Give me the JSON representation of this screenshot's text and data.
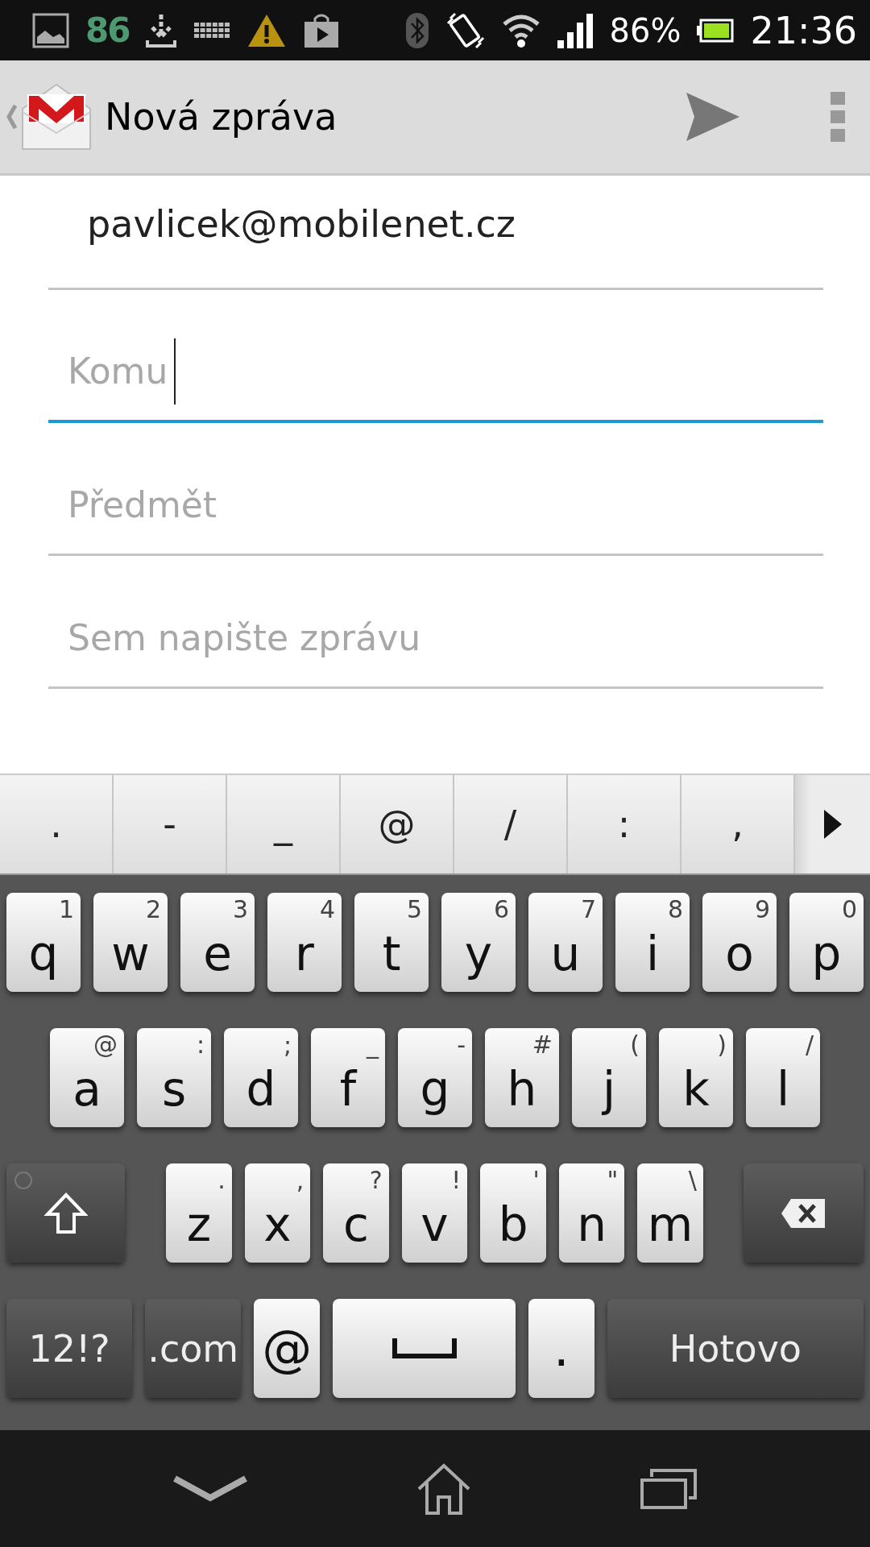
{
  "status_bar": {
    "notification_count": "86",
    "battery": "86%",
    "time": "21:36"
  },
  "action_bar": {
    "title": "Nová zpráva"
  },
  "compose": {
    "from": "pavlicek@mobilenet.cz",
    "fields": [
      {
        "placeholder": "Komu",
        "focused": true
      },
      {
        "placeholder": "Předmět",
        "focused": false
      },
      {
        "placeholder": "Sem napište zprávu",
        "focused": false
      }
    ]
  },
  "suggestions": [
    ".",
    "-",
    "_",
    "@",
    "/",
    ":",
    ","
  ],
  "keyboard": {
    "rows": [
      [
        {
          "kind": "char",
          "label": "q",
          "hint": "1"
        },
        {
          "kind": "char",
          "label": "w",
          "hint": "2"
        },
        {
          "kind": "char",
          "label": "e",
          "hint": "3"
        },
        {
          "kind": "char",
          "label": "r",
          "hint": "4"
        },
        {
          "kind": "char",
          "label": "t",
          "hint": "5"
        },
        {
          "kind": "char",
          "label": "y",
          "hint": "6"
        },
        {
          "kind": "char",
          "label": "u",
          "hint": "7"
        },
        {
          "kind": "char",
          "label": "i",
          "hint": "8"
        },
        {
          "kind": "char",
          "label": "o",
          "hint": "9"
        },
        {
          "kind": "char",
          "label": "p",
          "hint": "0"
        }
      ],
      [
        {
          "kind": "char",
          "label": "a",
          "hint": "@"
        },
        {
          "kind": "char",
          "label": "s",
          "hint": ":"
        },
        {
          "kind": "char",
          "label": "d",
          "hint": ";"
        },
        {
          "kind": "char",
          "label": "f",
          "hint": "_"
        },
        {
          "kind": "char",
          "label": "g",
          "hint": "-"
        },
        {
          "kind": "char",
          "label": "h",
          "hint": "#"
        },
        {
          "kind": "char",
          "label": "j",
          "hint": "("
        },
        {
          "kind": "char",
          "label": "k",
          "hint": ")"
        },
        {
          "kind": "char",
          "label": "l",
          "hint": "/"
        }
      ],
      [
        {
          "kind": "shift"
        },
        {
          "kind": "char",
          "label": "z",
          "hint": "."
        },
        {
          "kind": "char",
          "label": "x",
          "hint": ","
        },
        {
          "kind": "char",
          "label": "c",
          "hint": "?"
        },
        {
          "kind": "char",
          "label": "v",
          "hint": "!"
        },
        {
          "kind": "char",
          "label": "b",
          "hint": "'"
        },
        {
          "kind": "char",
          "label": "n",
          "hint": "\""
        },
        {
          "kind": "char",
          "label": "m",
          "hint": "\\"
        },
        {
          "kind": "backspace"
        }
      ],
      [
        {
          "kind": "function",
          "label": "12!?"
        },
        {
          "kind": "function",
          "label": ".com"
        },
        {
          "kind": "char",
          "label": "@"
        },
        {
          "kind": "space"
        },
        {
          "kind": "char",
          "label": "."
        },
        {
          "kind": "function",
          "label": "Hotovo"
        }
      ]
    ]
  }
}
